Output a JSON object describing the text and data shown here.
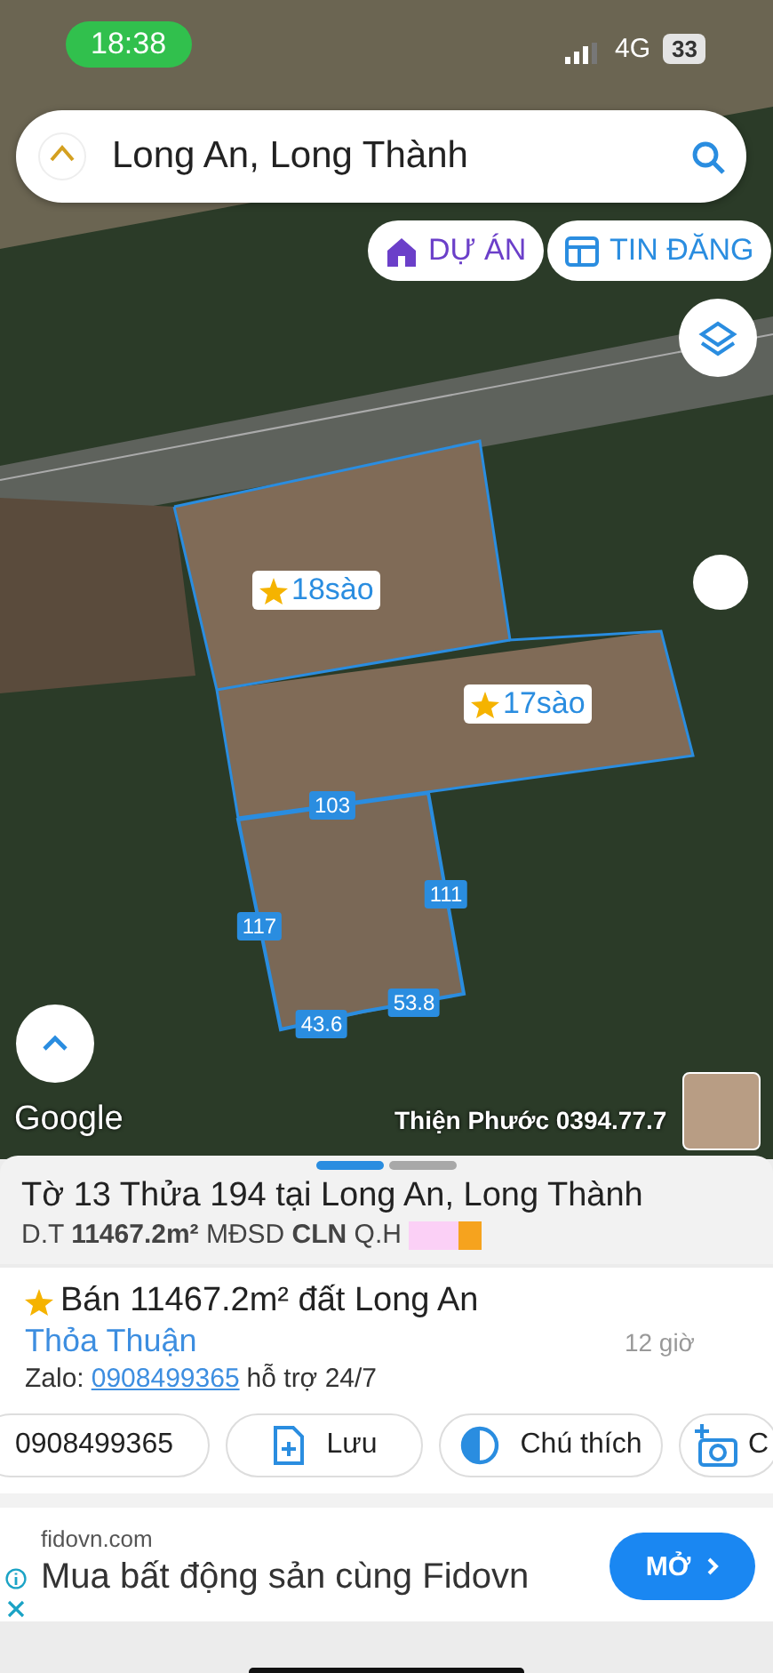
{
  "status_bar": {
    "time": "18:38",
    "network": "4G",
    "battery": "33"
  },
  "search": {
    "value": "Long An, Long Thành"
  },
  "map_buttons": [
    {
      "kind": "project",
      "label": "DỰ ÁN"
    },
    {
      "kind": "listing",
      "label": "TIN ĐĂNG"
    }
  ],
  "map": {
    "parcel_labels": [
      "18sào",
      "17sào"
    ],
    "edge_lengths": [
      "103",
      "111",
      "117",
      "53.8",
      "43.6"
    ],
    "attribution": "Google",
    "overlay_text": "Thiện Phước 0394.77.7"
  },
  "sheet": {
    "pager": [
      {
        "selected": true
      },
      {
        "selected": false
      }
    ],
    "title": "Tờ 13 Thửa 194 tại Long An, Long Thành",
    "details": "D.T **11467.2m²** MĐSD **CLN** Q.H",
    "zoning_colors": [
      {
        "color": "#fbd0f6"
      },
      {
        "color": "#f6a31e"
      }
    ]
  },
  "listing": {
    "title": "Bán 11467.2m² đất Long An",
    "price": "Thỏa Thuận",
    "time": "12 giờ",
    "contact_prefix": "Zalo:",
    "contact_link": "0908499365",
    "contact_suffix": "hỗ trợ 24/7"
  },
  "actions": [
    {
      "kind": "phone",
      "label": "0908499365"
    },
    {
      "kind": "save",
      "label": "Lưu"
    },
    {
      "kind": "legend",
      "label": "Chú thích"
    },
    {
      "kind": "photo",
      "label": "C"
    }
  ],
  "ad": {
    "domain": "fidovn.com",
    "headline": "Mua bất động sản cùng Fidovn",
    "button": "MỞ"
  }
}
